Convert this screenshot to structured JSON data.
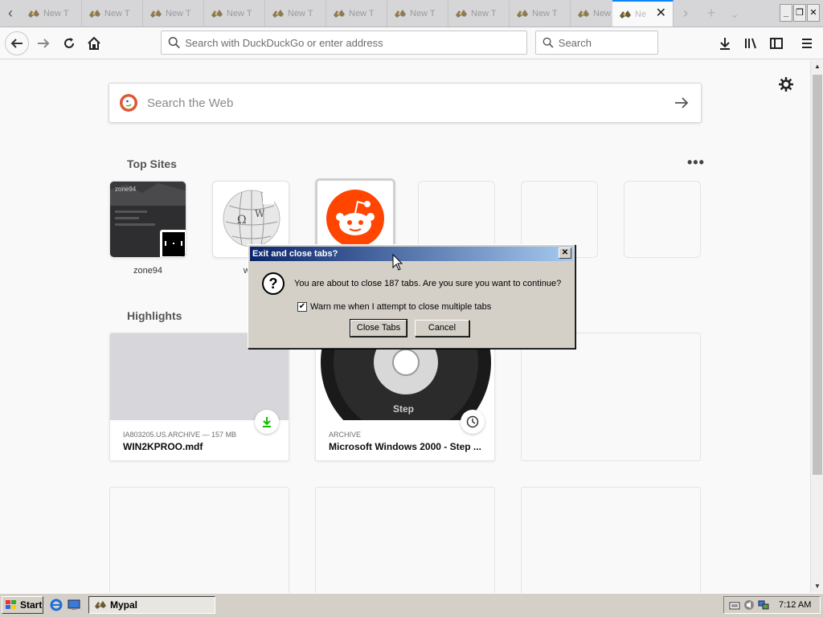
{
  "tabs": {
    "items": [
      {
        "title": "New T"
      },
      {
        "title": "New T"
      },
      {
        "title": "New T"
      },
      {
        "title": "New T"
      },
      {
        "title": "New T"
      },
      {
        "title": "New T"
      },
      {
        "title": "New T"
      },
      {
        "title": "New T"
      },
      {
        "title": "New T"
      },
      {
        "title": "New T"
      }
    ],
    "active_title": "Ne",
    "accent_color": "#0a84ff"
  },
  "toolbar": {
    "url_placeholder": "Search with DuckDuckGo or enter address",
    "search_placeholder": "Search",
    "icons": [
      "back-icon",
      "forward-icon",
      "reload-icon",
      "home-icon",
      "downloads-icon",
      "library-icon",
      "sidebar-icon",
      "menu-icon"
    ]
  },
  "newtab": {
    "search_placeholder": "Search the Web",
    "top_sites_title": "Top Sites",
    "highlights_title": "Highlights",
    "top_sites": [
      {
        "label": "zone94"
      },
      {
        "label": "wiki"
      },
      {
        "label": ""
      }
    ],
    "zone94_thumb_text": "zone94",
    "highlights": [
      {
        "source": "IA803205.US.ARCHIVE — 157 MB",
        "title": "WIN2KPROO.mdf",
        "badge": "download-icon"
      },
      {
        "source": "ARCHIVE",
        "title": "Microsoft Windows 2000 - Step ...",
        "badge": "clock-icon",
        "thumb_text": "Step"
      }
    ]
  },
  "dialog": {
    "title": "Exit and close tabs?",
    "message": "You are about to close 187 tabs. Are you sure you want to continue?",
    "checkbox_label": "Warn me when I attempt to close multiple tabs",
    "checkbox_checked": true,
    "close_button": "Close Tabs",
    "cancel_button": "Cancel"
  },
  "taskbar": {
    "start_label": "Start",
    "task_label": "Mypal",
    "clock": "7:12 AM"
  }
}
